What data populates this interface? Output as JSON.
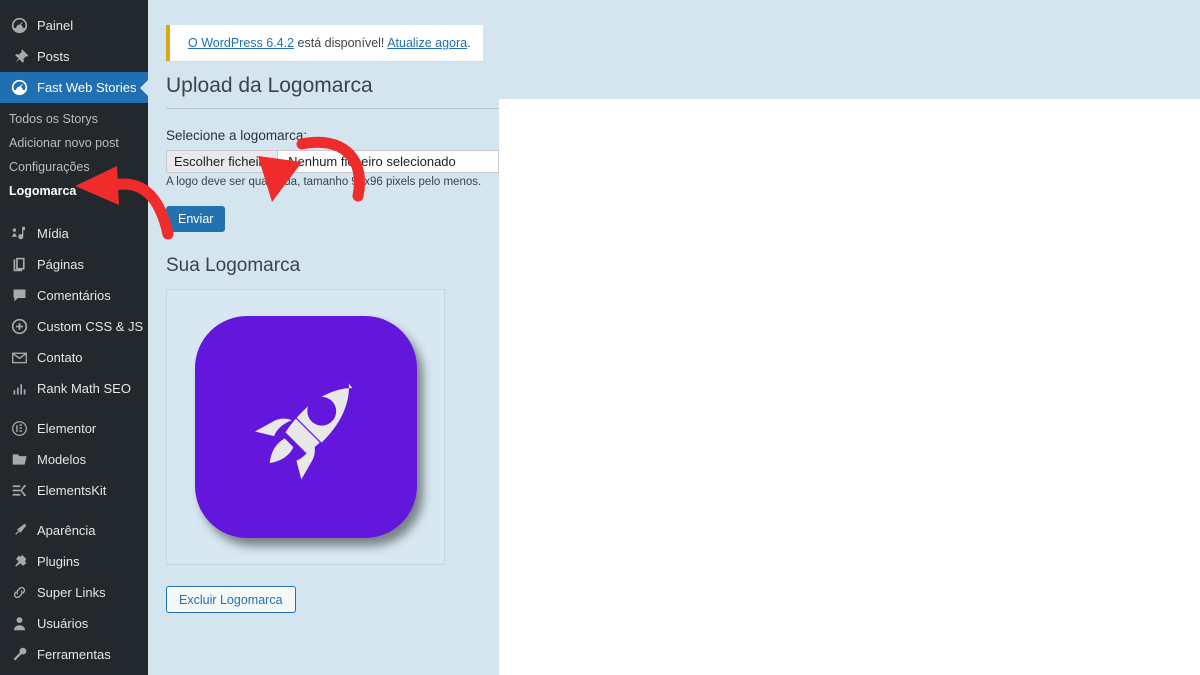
{
  "sidebar": {
    "items": [
      {
        "label": "Painel",
        "icon": "dashboard-icon",
        "type": "top"
      },
      {
        "label": "Posts",
        "icon": "pin-icon",
        "type": "top"
      },
      {
        "label": "Fast Web Stories",
        "icon": "dashboard-icon",
        "type": "top",
        "active": true
      },
      {
        "label": "Mídia",
        "icon": "media-icon",
        "type": "top"
      },
      {
        "label": "Páginas",
        "icon": "pages-icon",
        "type": "top"
      },
      {
        "label": "Comentários",
        "icon": "comment-icon",
        "type": "top"
      },
      {
        "label": "Custom CSS & JS",
        "icon": "plus-circle-icon",
        "type": "top"
      },
      {
        "label": "Contato",
        "icon": "envelope-icon",
        "type": "top"
      },
      {
        "label": "Rank Math SEO",
        "icon": "chart-icon",
        "type": "top"
      },
      {
        "label": "Elementor",
        "icon": "elementor-icon",
        "type": "top"
      },
      {
        "label": "Modelos",
        "icon": "folder-icon",
        "type": "top"
      },
      {
        "label": "ElementsKit",
        "icon": "elementskit-icon",
        "type": "top"
      },
      {
        "label": "Aparência",
        "icon": "brush-icon",
        "type": "top"
      },
      {
        "label": "Plugins",
        "icon": "plug-icon",
        "type": "top"
      },
      {
        "label": "Super Links",
        "icon": "link-icon",
        "type": "top"
      },
      {
        "label": "Usuários",
        "icon": "user-icon",
        "type": "top"
      },
      {
        "label": "Ferramentas",
        "icon": "tools-icon",
        "type": "top"
      }
    ],
    "submenu": [
      {
        "label": "Todos os Storys",
        "current": false
      },
      {
        "label": "Adicionar novo post",
        "current": false
      },
      {
        "label": "Configurações",
        "current": false
      },
      {
        "label": "Logomarca",
        "current": true
      }
    ]
  },
  "notice": {
    "link_version": "O WordPress 6.4.2",
    "middle_text": " está disponível! ",
    "link_update": "Atualize agora",
    "end_text": "."
  },
  "main": {
    "page_title": "Upload da Logomarca",
    "field_label": "Selecione a logomarca:",
    "file_button": "Escolher ficheiro",
    "file_status": "Nenhum ficheiro selecionado",
    "help_text": "A logo deve ser quadrada, tamanho 96x96 pixels pelo menos.",
    "submit_label": "Enviar",
    "section_title": "Sua Logomarca",
    "delete_label": "Excluir Logomarca",
    "logo_alt": "rocket-logo"
  },
  "colors": {
    "sidebar_bg": "#23282d",
    "active_blue": "#1f6fb2",
    "panel_blue": "#d4e5f0",
    "accent_blue": "#2271b1",
    "notice_accent": "#dba617",
    "logo_purple": "#6317dd",
    "annotation_red": "#ef2b2b"
  }
}
